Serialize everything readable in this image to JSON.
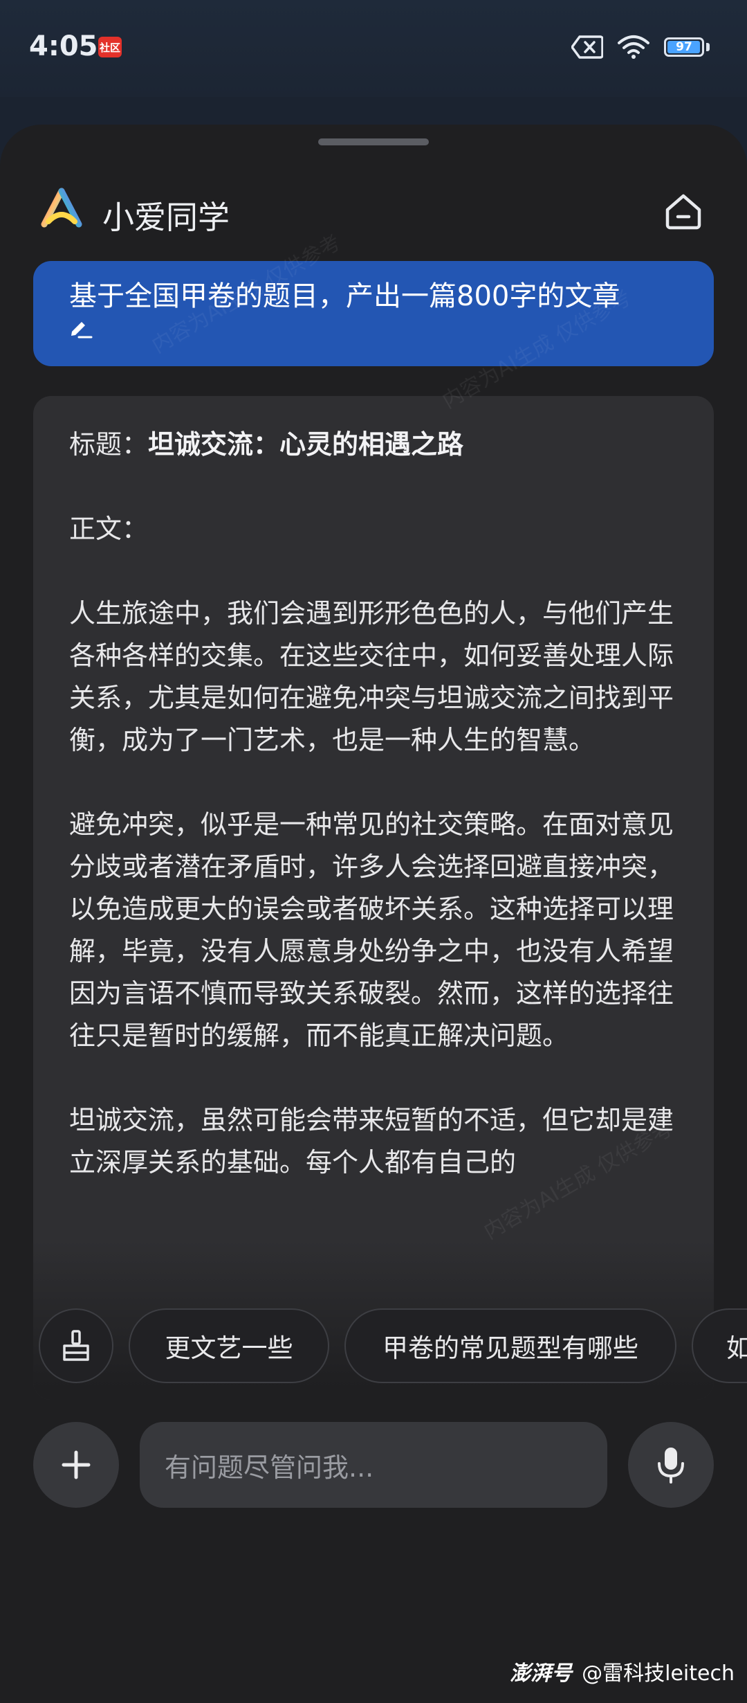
{
  "status_bar": {
    "time": "4:05",
    "badge": "社区",
    "battery": "97",
    "battery_level": 0.97
  },
  "app": {
    "title": "小爱同学"
  },
  "prompt": {
    "text": "基于全国甲卷的题目，产出一篇800字的文章"
  },
  "answer": {
    "title_label": "标题：",
    "title_value": "坦诚交流：心灵的相遇之路",
    "body_label": "正文：",
    "paragraphs": [
      "人生旅途中，我们会遇到形形色色的人，与他们产生各种各样的交集。在这些交往中，如何妥善处理人际关系，尤其是如何在避免冲突与坦诚交流之间找到平衡，成为了一门艺术，也是一种人生的智慧。",
      "避免冲突，似乎是一种常见的社交策略。在面对意见分歧或者潜在矛盾时，许多人会选择回避直接冲突，以免造成更大的误会或者破坏关系。这种选择可以理解，毕竟，没有人愿意身处纷争之中，也没有人希望因为言语不慎而导致关系破裂。然而，这样的选择往往只是暂时的缓解，而不能真正解决问题。",
      "坦诚交流，虽然可能会带来短暂的不适，但它却是建立深厚关系的基础。每个人都有自己的"
    ]
  },
  "suggestions": [
    "更文艺一些",
    "甲卷的常见题型有哪些",
    "如何"
  ],
  "input": {
    "placeholder": "有问题尽管问我..."
  },
  "watermark": {
    "brand": "澎湃号",
    "account": "@雷科技leitech",
    "overlay": "内容为AI生成 仅供参考"
  },
  "colors": {
    "accent": "#2356b3",
    "card": "#2f2f32",
    "sheet": "#1f1f21"
  }
}
